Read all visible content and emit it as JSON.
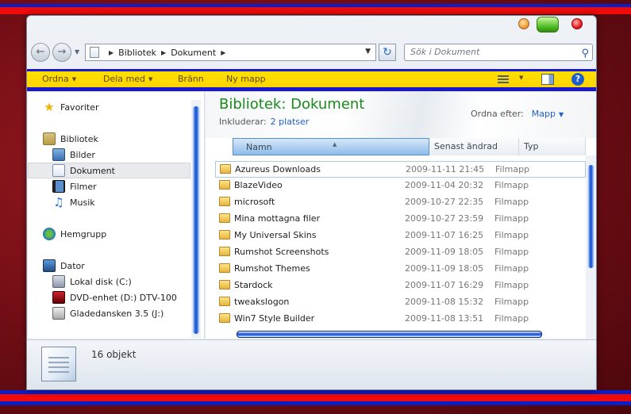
{
  "window": {
    "address": {
      "crumbs": [
        "Bibliotek",
        "Dokument"
      ]
    },
    "search": {
      "placeholder": "Sök i Dokument"
    }
  },
  "toolbar": {
    "organize": "Ordna",
    "share": "Dela med",
    "burn": "Bränn",
    "new_folder": "Ny mapp"
  },
  "sidebar": {
    "favorites": "Favoriter",
    "libraries": "Bibliotek",
    "library_items": [
      "Bilder",
      "Dokument",
      "Filmer",
      "Musik"
    ],
    "homegroup": "Hemgrupp",
    "computer": "Dator",
    "drives": [
      "Lokal disk (C:)",
      "DVD-enhet (D:) DTV-100",
      "Gladedansken 3.5 (J:)"
    ]
  },
  "library": {
    "title": "Bibliotek: Dokument",
    "includes_label": "Inkluderar:",
    "includes_link": "2 platser",
    "arrange_label": "Ordna efter:",
    "arrange_value": "Mapp"
  },
  "columns": {
    "name": "Namn",
    "modified": "Senast ändrad",
    "type": "Typ"
  },
  "files": [
    {
      "name": "Azureus Downloads",
      "date": "2009-11-11 21:45",
      "type": "Filmapp"
    },
    {
      "name": "BlazeVideo",
      "date": "2009-11-04 20:32",
      "type": "Filmapp"
    },
    {
      "name": "microsoft",
      "date": "2009-10-27 22:35",
      "type": "Filmapp"
    },
    {
      "name": "Mina mottagna filer",
      "date": "2009-10-27 23:59",
      "type": "Filmapp"
    },
    {
      "name": "My Universal Skins",
      "date": "2009-11-07 16:25",
      "type": "Filmapp"
    },
    {
      "name": "Rumshot Screenshots",
      "date": "2009-11-09 18:05",
      "type": "Filmapp"
    },
    {
      "name": "Rumshot Themes",
      "date": "2009-11-09 18:05",
      "type": "Filmapp"
    },
    {
      "name": "Stardock",
      "date": "2009-11-07 16:29",
      "type": "Filmapp"
    },
    {
      "name": "tweakslogon",
      "date": "2009-11-08 15:32",
      "type": "Filmapp"
    },
    {
      "name": "Win7 Style Builder",
      "date": "2009-11-08 13:51",
      "type": "Filmapp"
    }
  ],
  "status": {
    "count": "16 objekt"
  },
  "colors": {
    "stripe_blue": "#0a1ec8",
    "stripe_red": "#f00a0a",
    "title_green": "#1a8a1a",
    "link_blue": "#1e5fd0",
    "toolbar_yellow": "#ffe000"
  }
}
